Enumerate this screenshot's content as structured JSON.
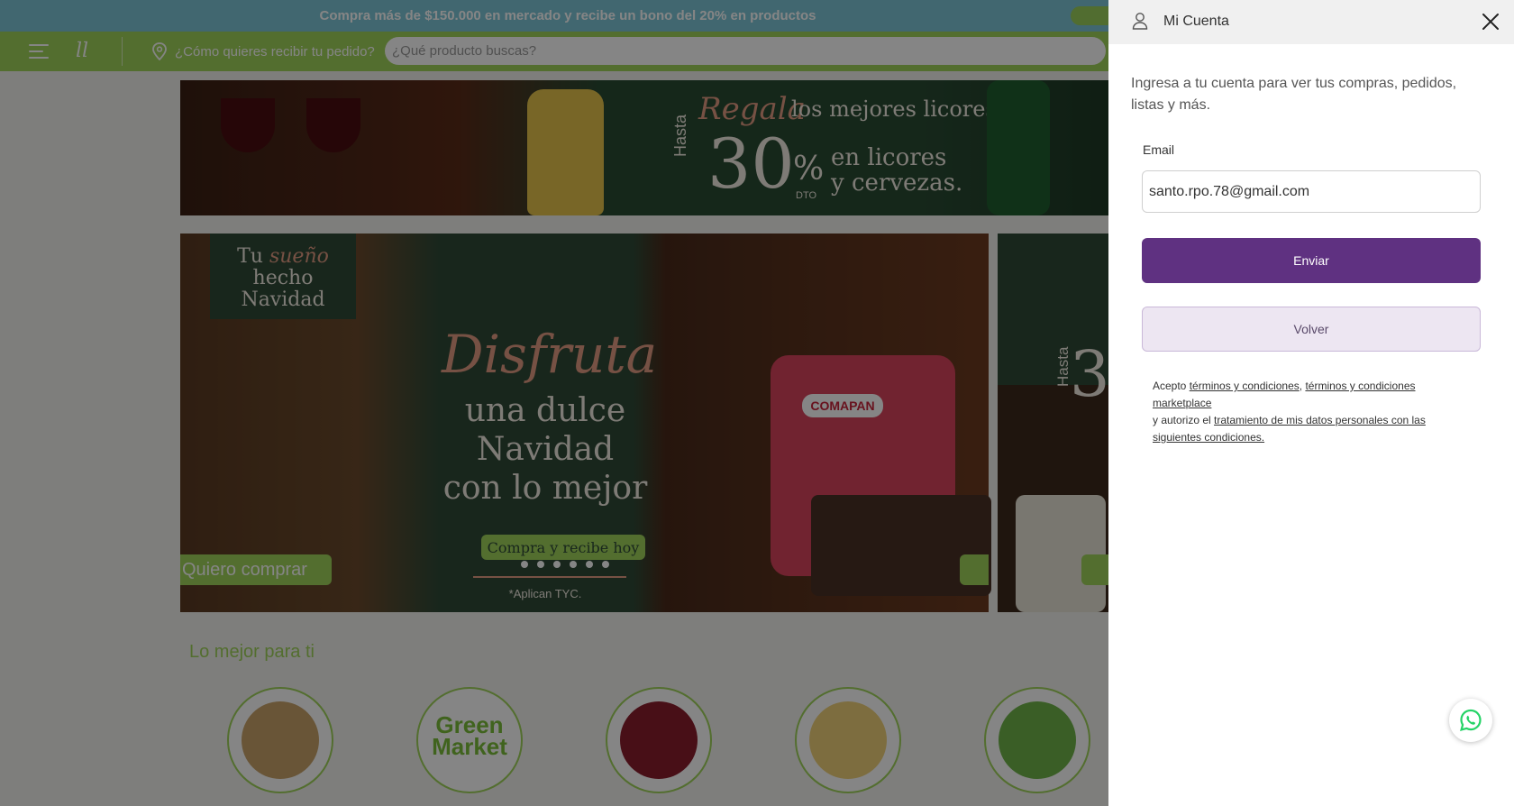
{
  "promo": {
    "text": "Compra más de $150.000 en mercado y recibe un bono del 20% en productos"
  },
  "header": {
    "logo_text": "ll",
    "delivery_label": "¿Cómo quieres recibir tu pedido?",
    "search_placeholder": "¿Qué producto buscas?"
  },
  "hero_banner": {
    "regala": "Regala",
    "mejores": "los mejores licores",
    "hasta": "Hasta",
    "number": "30",
    "percent": "%",
    "dto": "DTO",
    "line1": "en licores",
    "line2": "y cervezas."
  },
  "carousel": {
    "tu": "Tu ",
    "sueno": "sueño",
    "hecho": "hecho Navidad",
    "disfruta": "Disfruta",
    "dulce1": "una dulce",
    "dulce2": "Navidad",
    "dulce3": "con lo mejor",
    "badge": "Compra y recibe hoy",
    "aplican": "*Aplican TYC.",
    "quiero": "Quiero comprar",
    "panettone_brand": "COMAPAN",
    "next_hasta": "Hasta",
    "next_number": "3",
    "dots_count": 6
  },
  "section": {
    "title": "Lo mejor para ti"
  },
  "categories": [
    {
      "name": "basket",
      "color": "#c9a46a"
    },
    {
      "name": "green-market",
      "line1": "Green",
      "line2": "Market",
      "color": "#7cbf3a"
    },
    {
      "name": "wine",
      "color": "#8b1e2d"
    },
    {
      "name": "dairy",
      "color": "#f0d27a"
    },
    {
      "name": "salad",
      "color": "#6fb54a"
    }
  ],
  "drawer": {
    "title": "Mi Cuenta",
    "description": "Ingresa a tu cuenta para ver tus compras, pedidos, listas y más.",
    "email_label": "Email",
    "email_value": "santo.rpo.78@gmail.com",
    "send_label": "Enviar",
    "back_label": "Volver",
    "terms_prefix": "Acepto ",
    "terms_link1": "términos y condiciones",
    "terms_sep": ", ",
    "terms_link2": "términos y condiciones marketplace",
    "terms_mid": " y autorizo el ",
    "terms_link3": "tratamiento de mis datos personales con las siguientes condiciones."
  },
  "colors": {
    "primary_purple": "#5f3181",
    "brand_green": "#9fd35b",
    "promo_blue": "#7ec6d7",
    "whatsapp_green": "#25d366"
  }
}
